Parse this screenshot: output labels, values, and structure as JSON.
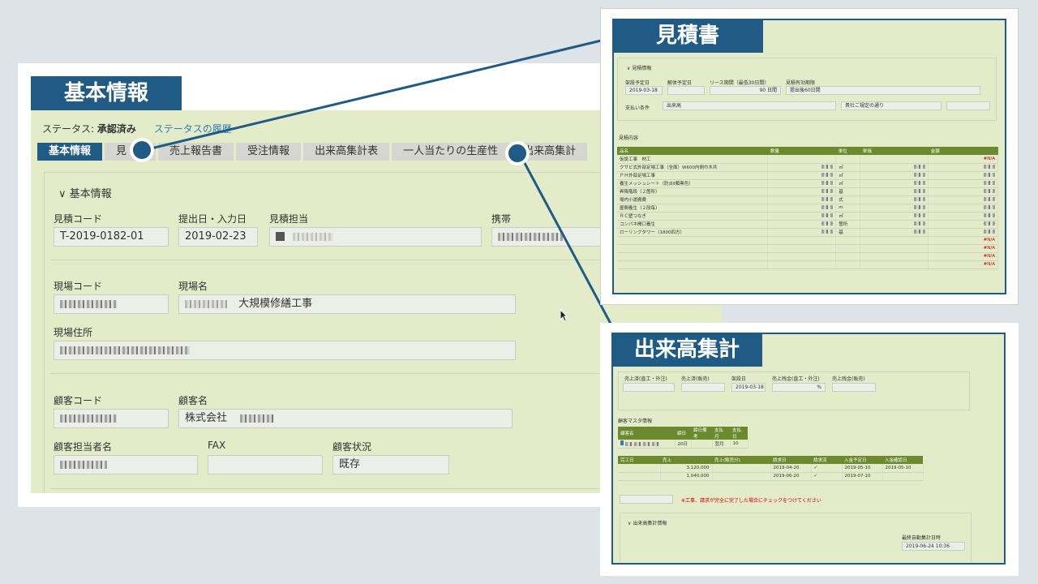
{
  "basic": {
    "title": "基本情報",
    "status_label": "ステータス:",
    "status_value": "承認済み",
    "status_history": "ステータスの履歴",
    "tabs": [
      "基本情報",
      "見",
      "売上報告書",
      "受注情報",
      "出来高集計表",
      "一人当たりの生産性",
      "出来高集計"
    ],
    "section_title": "基本情報",
    "estimate_code_label": "見積コード",
    "estimate_code": "T-2019-0182-01",
    "submit_date_label": "提出日・入力日",
    "submit_date": "2019-02-23",
    "estimate_person_label": "見積担当",
    "mobile_label": "携帯",
    "site_code_label": "現場コード",
    "site_name_label": "現場名",
    "site_name": "大規模修繕工事",
    "site_address_label": "現場住所",
    "customer_code_label": "顧客コード",
    "customer_name_label": "顧客名",
    "customer_name": "株式会社",
    "customer_person_label": "顧客担当者名",
    "fax_label": "FAX",
    "customer_status_label": "顧客状況",
    "customer_status": "既存"
  },
  "quote": {
    "title": "見積書",
    "section": "見積情報",
    "f1": "架設予定日",
    "v1": "2019-03-18",
    "f2": "解体予定日",
    "f3": "リース期間（最低30日間）",
    "v3": "90 日間",
    "f4": "見積有効期限",
    "v4": "提出後60日間",
    "f5": "支払い条件",
    "v5": "出来高",
    "v6": "貴社ご規定の通り",
    "content_label": "見積内容",
    "headers": [
      "品名",
      "数量",
      "単位",
      "単価",
      "金額"
    ],
    "rows": [
      {
        "name": "仮設工事　材工",
        "unit": ""
      },
      {
        "name": "クサビ式外部足場工事（全面）W600内側巾木共",
        "unit": "㎡"
      },
      {
        "name": "ＰＨ外部足場工事",
        "unit": "㎡"
      },
      {
        "name": "養生メッシュシート（防炎Ⅱ類黒色）",
        "unit": "㎡"
      },
      {
        "name": "昇降階段（２箇所）",
        "unit": "基"
      },
      {
        "name": "場内小運搬費",
        "unit": "式"
      },
      {
        "name": "屋間養生（２段毎）",
        "unit": "m"
      },
      {
        "name": "ＲＣ壁つなぎ",
        "unit": "㎡"
      },
      {
        "name": "コンパネ開口養生",
        "unit": "箇所"
      },
      {
        "name": "ローリングタワー（1800四方）",
        "unit": "基"
      },
      {
        "name": "",
        "unit": ""
      },
      {
        "name": "",
        "unit": ""
      },
      {
        "name": "",
        "unit": ""
      },
      {
        "name": "",
        "unit": ""
      }
    ],
    "error": "#N/A"
  },
  "summary": {
    "title": "出来高集計",
    "f1": "売上済(直工・外注)",
    "f2": "売上済(販売)",
    "f3": "架設日",
    "v3": "2019-03-18",
    "f4": "売上残金(直工・外注)",
    "v4": "%",
    "f5": "売上残金(販売)",
    "master_label": "顧客マスタ情報",
    "master_headers": [
      "顧客名",
      "締日",
      "締日備考",
      "支払月",
      "支払日"
    ],
    "master_row": [
      "",
      "20日",
      "",
      "翌月",
      "10"
    ],
    "bill_headers": [
      "完工日",
      "売上",
      "売上(販売分)",
      "請求日",
      "請求済",
      "入金予定日",
      "入金確認日"
    ],
    "bill_rows": [
      [
        "",
        "3,120,000",
        "",
        "2019-04-20",
        "✓",
        "2019-05-10",
        "2019-05-10"
      ],
      [
        "",
        "1,040,000",
        "",
        "2019-06-20",
        "✓",
        "2019-07-10",
        ""
      ]
    ],
    "note": "※工事、請求が完全に完了した場合にチェックをつけてください",
    "section": "出来高集計情報",
    "auto_label": "最終自動集計日時",
    "auto_value": "2019-06-24 10:36"
  }
}
